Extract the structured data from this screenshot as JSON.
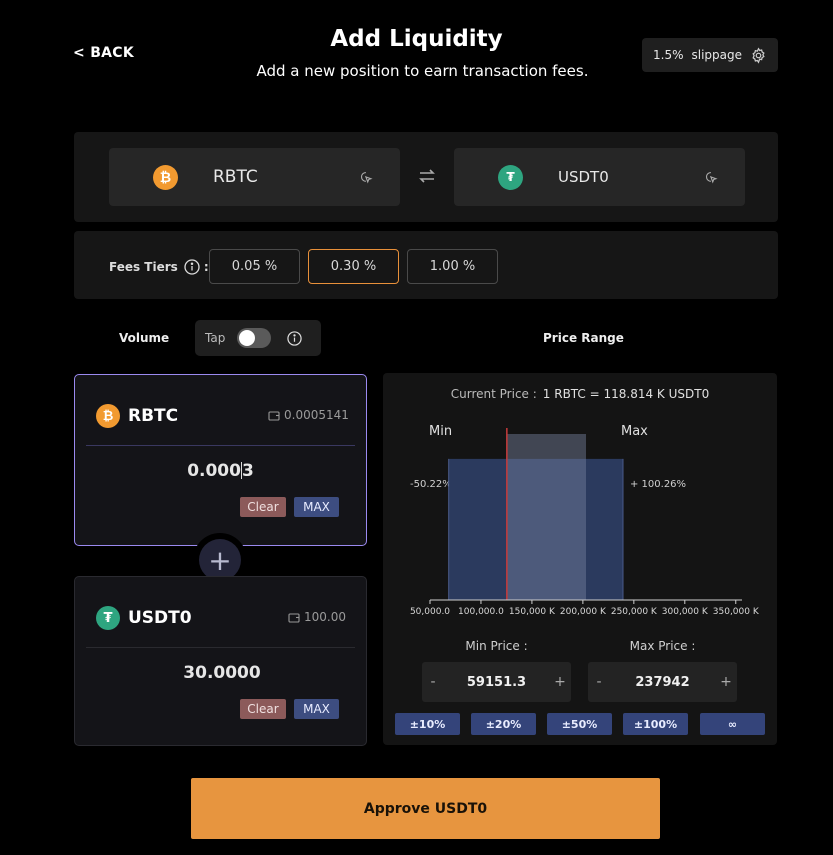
{
  "header": {
    "back_label": "< BACK",
    "title": "Add Liquidity",
    "subtitle": "Add a new position to earn transaction fees.",
    "slippage_value": "1.5%",
    "slippage_label": "slippage"
  },
  "pair": {
    "token_a": {
      "symbol": "RBTC",
      "icon": "bitcoin-icon",
      "color": "#f29a30"
    },
    "token_b": {
      "symbol": "USDT0",
      "icon": "tether-icon",
      "color": "#2ea580"
    }
  },
  "fees": {
    "label": "Fees Tiers",
    "tiers": [
      "0.05 %",
      "0.30 %",
      "1.00 %"
    ],
    "selected": "0.30 %"
  },
  "volume": {
    "label": "Volume",
    "tap_label": "Tap",
    "tap_enabled": false
  },
  "deposit_a": {
    "symbol": "RBTC",
    "balance": "0.0005141",
    "amount_before_cursor": "0.000",
    "amount_after_cursor": "3",
    "clear_label": "Clear",
    "max_label": "MAX"
  },
  "deposit_b": {
    "symbol": "USDT0",
    "balance": "100.00",
    "amount": "30.0000",
    "clear_label": "Clear",
    "max_label": "MAX"
  },
  "price_range": {
    "label": "Price Range",
    "current_price_label": "Current Price :",
    "current_price": "1 RBTC = 118.814 K USDT0",
    "min_label": "Min",
    "max_label": "Max",
    "min_pct": "-50.22%",
    "max_pct": "+ 100.26%",
    "min_price_label": "Min Price :",
    "max_price_label": "Max Price :",
    "min_price": "59151.3",
    "max_price": "237942",
    "decrement": "-",
    "increment": "+",
    "presets": [
      "±10%",
      "±20%",
      "±50%",
      "±100%",
      "∞"
    ]
  },
  "chart_data": {
    "type": "bar",
    "x_ticks": [
      "50,000.0",
      "100,000.0",
      "150,000 K",
      "200,000 K",
      "250,000 K",
      "300,000 K",
      "350,000 K"
    ],
    "xlim": [
      40000,
      360000
    ],
    "current_price": 118814,
    "min_price": 59151.3,
    "max_price": 237942,
    "liquidity_bars": [
      {
        "from": 118814,
        "to": 200000,
        "value": 1.0
      }
    ],
    "selected_range_value": 0.85
  },
  "action": {
    "approve_label": "Approve USDT0",
    "color": "#e7953f"
  }
}
